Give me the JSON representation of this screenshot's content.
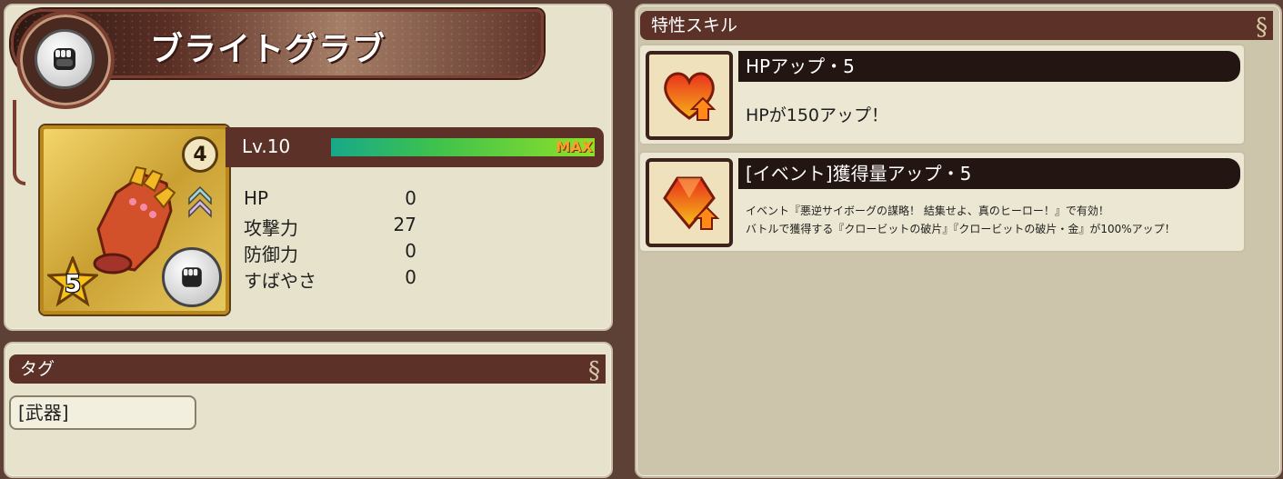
{
  "item": {
    "name": "ブライトグラブ",
    "rarity": "4",
    "stars": "5",
    "level": "Lv.10",
    "max_label": "MAX",
    "exp_fraction": 1.0,
    "stats": [
      {
        "label": "HP",
        "value": "0"
      },
      {
        "label": "攻撃力",
        "value": "27"
      },
      {
        "label": "防御力",
        "value": "0"
      },
      {
        "label": "すばやさ",
        "value": "0"
      }
    ]
  },
  "tags": {
    "header": "タグ",
    "items": [
      "[武器]"
    ]
  },
  "skills": {
    "header": "特性スキル",
    "list": [
      {
        "name": "HPアップ・5",
        "icon": "heart-up-icon",
        "description": "HPが150アップ！"
      },
      {
        "name": "[イベント]獲得量アップ・5",
        "icon": "gem-up-icon",
        "description_lines": [
          "イベント『悪逆サイボーグの謀略！ 結集せよ、真のヒーロー！』で有効！",
          "バトルで獲得する『クロービットの破片』『クロービットの破片・金』が100%アップ！"
        ]
      }
    ]
  },
  "colors": {
    "header_bar": "#5b3128",
    "panel_bg": "#e6e2cb",
    "exp_bar_start": "#17a98a",
    "exp_bar_end": "#8ee029",
    "max_text": "#ff9d2a"
  }
}
